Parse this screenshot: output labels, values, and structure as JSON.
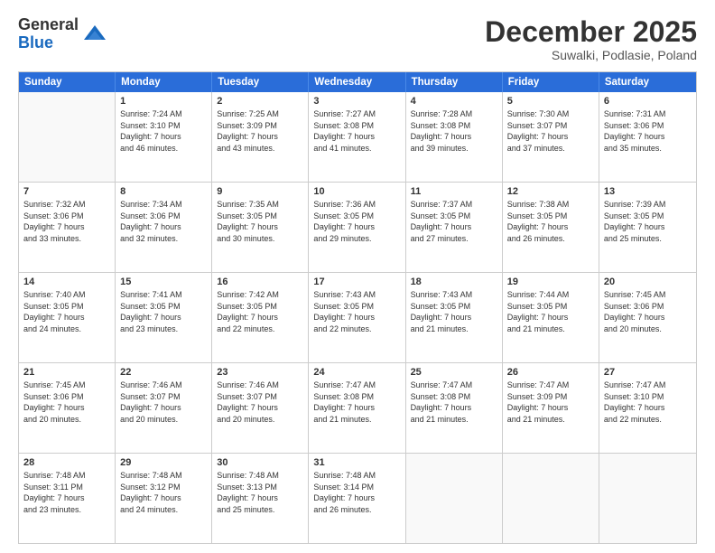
{
  "header": {
    "logo_line1": "General",
    "logo_line2": "Blue",
    "month": "December 2025",
    "location": "Suwalki, Podlasie, Poland"
  },
  "days_of_week": [
    "Sunday",
    "Monday",
    "Tuesday",
    "Wednesday",
    "Thursday",
    "Friday",
    "Saturday"
  ],
  "weeks": [
    [
      {
        "day": "",
        "lines": [],
        "empty": true
      },
      {
        "day": "1",
        "lines": [
          "Sunrise: 7:24 AM",
          "Sunset: 3:10 PM",
          "Daylight: 7 hours",
          "and 46 minutes."
        ]
      },
      {
        "day": "2",
        "lines": [
          "Sunrise: 7:25 AM",
          "Sunset: 3:09 PM",
          "Daylight: 7 hours",
          "and 43 minutes."
        ]
      },
      {
        "day": "3",
        "lines": [
          "Sunrise: 7:27 AM",
          "Sunset: 3:08 PM",
          "Daylight: 7 hours",
          "and 41 minutes."
        ]
      },
      {
        "day": "4",
        "lines": [
          "Sunrise: 7:28 AM",
          "Sunset: 3:08 PM",
          "Daylight: 7 hours",
          "and 39 minutes."
        ]
      },
      {
        "day": "5",
        "lines": [
          "Sunrise: 7:30 AM",
          "Sunset: 3:07 PM",
          "Daylight: 7 hours",
          "and 37 minutes."
        ]
      },
      {
        "day": "6",
        "lines": [
          "Sunrise: 7:31 AM",
          "Sunset: 3:06 PM",
          "Daylight: 7 hours",
          "and 35 minutes."
        ]
      }
    ],
    [
      {
        "day": "7",
        "lines": [
          "Sunrise: 7:32 AM",
          "Sunset: 3:06 PM",
          "Daylight: 7 hours",
          "and 33 minutes."
        ]
      },
      {
        "day": "8",
        "lines": [
          "Sunrise: 7:34 AM",
          "Sunset: 3:06 PM",
          "Daylight: 7 hours",
          "and 32 minutes."
        ]
      },
      {
        "day": "9",
        "lines": [
          "Sunrise: 7:35 AM",
          "Sunset: 3:05 PM",
          "Daylight: 7 hours",
          "and 30 minutes."
        ]
      },
      {
        "day": "10",
        "lines": [
          "Sunrise: 7:36 AM",
          "Sunset: 3:05 PM",
          "Daylight: 7 hours",
          "and 29 minutes."
        ]
      },
      {
        "day": "11",
        "lines": [
          "Sunrise: 7:37 AM",
          "Sunset: 3:05 PM",
          "Daylight: 7 hours",
          "and 27 minutes."
        ]
      },
      {
        "day": "12",
        "lines": [
          "Sunrise: 7:38 AM",
          "Sunset: 3:05 PM",
          "Daylight: 7 hours",
          "and 26 minutes."
        ]
      },
      {
        "day": "13",
        "lines": [
          "Sunrise: 7:39 AM",
          "Sunset: 3:05 PM",
          "Daylight: 7 hours",
          "and 25 minutes."
        ]
      }
    ],
    [
      {
        "day": "14",
        "lines": [
          "Sunrise: 7:40 AM",
          "Sunset: 3:05 PM",
          "Daylight: 7 hours",
          "and 24 minutes."
        ]
      },
      {
        "day": "15",
        "lines": [
          "Sunrise: 7:41 AM",
          "Sunset: 3:05 PM",
          "Daylight: 7 hours",
          "and 23 minutes."
        ]
      },
      {
        "day": "16",
        "lines": [
          "Sunrise: 7:42 AM",
          "Sunset: 3:05 PM",
          "Daylight: 7 hours",
          "and 22 minutes."
        ]
      },
      {
        "day": "17",
        "lines": [
          "Sunrise: 7:43 AM",
          "Sunset: 3:05 PM",
          "Daylight: 7 hours",
          "and 22 minutes."
        ]
      },
      {
        "day": "18",
        "lines": [
          "Sunrise: 7:43 AM",
          "Sunset: 3:05 PM",
          "Daylight: 7 hours",
          "and 21 minutes."
        ]
      },
      {
        "day": "19",
        "lines": [
          "Sunrise: 7:44 AM",
          "Sunset: 3:05 PM",
          "Daylight: 7 hours",
          "and 21 minutes."
        ]
      },
      {
        "day": "20",
        "lines": [
          "Sunrise: 7:45 AM",
          "Sunset: 3:06 PM",
          "Daylight: 7 hours",
          "and 20 minutes."
        ]
      }
    ],
    [
      {
        "day": "21",
        "lines": [
          "Sunrise: 7:45 AM",
          "Sunset: 3:06 PM",
          "Daylight: 7 hours",
          "and 20 minutes."
        ]
      },
      {
        "day": "22",
        "lines": [
          "Sunrise: 7:46 AM",
          "Sunset: 3:07 PM",
          "Daylight: 7 hours",
          "and 20 minutes."
        ]
      },
      {
        "day": "23",
        "lines": [
          "Sunrise: 7:46 AM",
          "Sunset: 3:07 PM",
          "Daylight: 7 hours",
          "and 20 minutes."
        ]
      },
      {
        "day": "24",
        "lines": [
          "Sunrise: 7:47 AM",
          "Sunset: 3:08 PM",
          "Daylight: 7 hours",
          "and 21 minutes."
        ]
      },
      {
        "day": "25",
        "lines": [
          "Sunrise: 7:47 AM",
          "Sunset: 3:08 PM",
          "Daylight: 7 hours",
          "and 21 minutes."
        ]
      },
      {
        "day": "26",
        "lines": [
          "Sunrise: 7:47 AM",
          "Sunset: 3:09 PM",
          "Daylight: 7 hours",
          "and 21 minutes."
        ]
      },
      {
        "day": "27",
        "lines": [
          "Sunrise: 7:47 AM",
          "Sunset: 3:10 PM",
          "Daylight: 7 hours",
          "and 22 minutes."
        ]
      }
    ],
    [
      {
        "day": "28",
        "lines": [
          "Sunrise: 7:48 AM",
          "Sunset: 3:11 PM",
          "Daylight: 7 hours",
          "and 23 minutes."
        ]
      },
      {
        "day": "29",
        "lines": [
          "Sunrise: 7:48 AM",
          "Sunset: 3:12 PM",
          "Daylight: 7 hours",
          "and 24 minutes."
        ]
      },
      {
        "day": "30",
        "lines": [
          "Sunrise: 7:48 AM",
          "Sunset: 3:13 PM",
          "Daylight: 7 hours",
          "and 25 minutes."
        ]
      },
      {
        "day": "31",
        "lines": [
          "Sunrise: 7:48 AM",
          "Sunset: 3:14 PM",
          "Daylight: 7 hours",
          "and 26 minutes."
        ]
      },
      {
        "day": "",
        "lines": [],
        "empty": true
      },
      {
        "day": "",
        "lines": [],
        "empty": true
      },
      {
        "day": "",
        "lines": [],
        "empty": true
      }
    ]
  ]
}
